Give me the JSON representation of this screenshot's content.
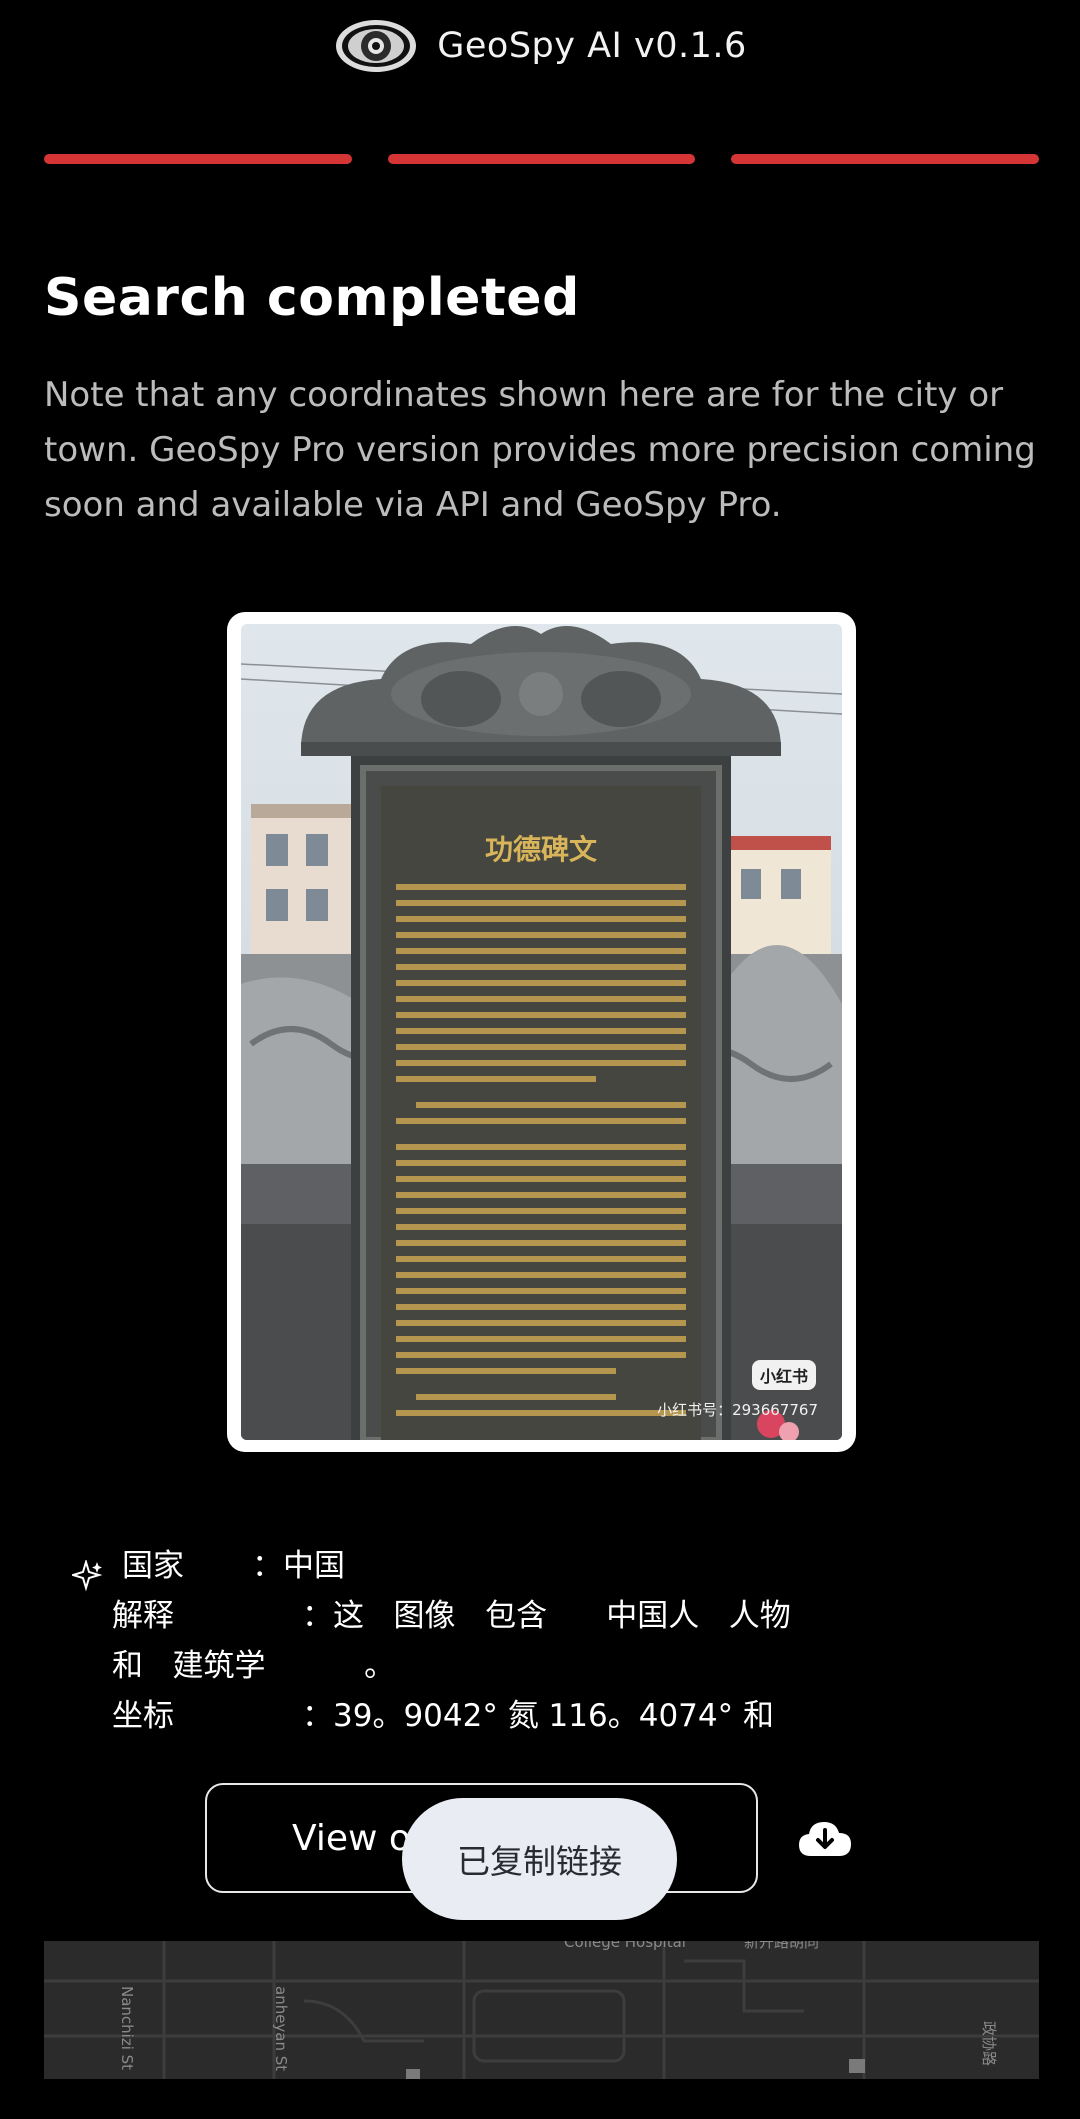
{
  "header": {
    "title": "GeoSpy AI v0.1.6",
    "logo_icon": "eye-logo-icon"
  },
  "progress": {
    "steps": 3,
    "completed": 3,
    "color": "#d63535"
  },
  "main": {
    "heading": "Search completed",
    "note": "Note that any coordinates shown here are for the city or town. GeoSpy Pro version provides more precision coming soon and available via API and GeoSpy Pro."
  },
  "photo": {
    "description_icon": "uploaded-photo",
    "watermark_badge": "小红书",
    "watermark_id": "小红书号：293667767"
  },
  "result": {
    "country_label": "国家",
    "country_value": "：中国",
    "explanation_label": "解释",
    "explanation_value": "：这   图像   包含      中国人   人物",
    "explanation_cont": "和   建筑学          。",
    "coords_label": "坐标",
    "coords_value": "：39。9042° 氮 116。4074° 和"
  },
  "actions": {
    "view_button_label": "View o",
    "download_icon": "cloud-download-icon"
  },
  "toast": {
    "text": "已复制链接"
  },
  "map": {
    "labels": [
      "College Hospital",
      "新开路胡同",
      "Nanchizi St",
      "anheyan St",
      "政协路"
    ]
  }
}
